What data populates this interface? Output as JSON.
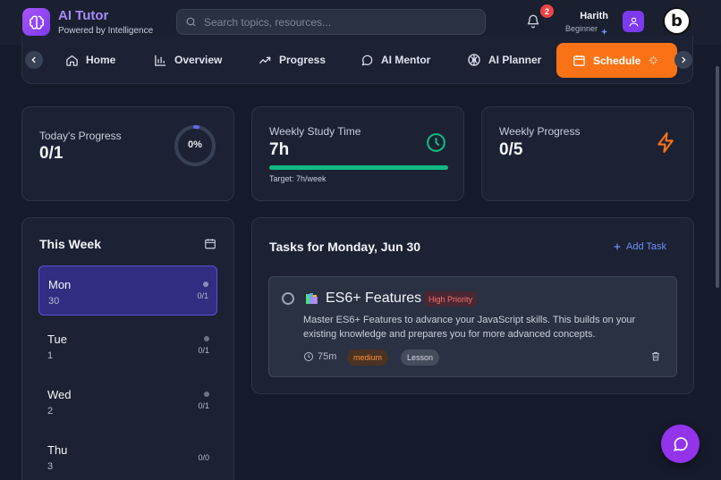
{
  "header": {
    "brand_title": "AI Tutor",
    "brand_subtitle": "Powered by Intelligence",
    "search_placeholder": "Search topics, resources...",
    "notification_count": "2",
    "user_name": "Harith",
    "user_level": "Beginner"
  },
  "nav": {
    "items": [
      {
        "label": "Home",
        "icon": "home-icon"
      },
      {
        "label": "Overview",
        "icon": "bar-chart-icon"
      },
      {
        "label": "Progress",
        "icon": "trending-up-icon"
      },
      {
        "label": "AI Mentor",
        "icon": "chat-icon"
      },
      {
        "label": "AI Planner",
        "icon": "brain-icon"
      },
      {
        "label": "Schedule",
        "icon": "calendar-icon",
        "active": true
      }
    ]
  },
  "stats": {
    "today": {
      "label": "Today's Progress",
      "value": "0/1",
      "percent_text": "0%",
      "percent": 0
    },
    "weekly_time": {
      "label": "Weekly Study Time",
      "value": "7h",
      "target": "Target: 7h/week",
      "fill_fraction": 1.0
    },
    "weekly_progress": {
      "label": "Weekly Progress",
      "value": "0/5"
    }
  },
  "week": {
    "title": "This Week",
    "days": [
      {
        "name": "Mon",
        "num": "30",
        "count": "0/1",
        "active": true
      },
      {
        "name": "Tue",
        "num": "1",
        "count": "0/1"
      },
      {
        "name": "Wed",
        "num": "2",
        "count": "0/1"
      },
      {
        "name": "Thu",
        "num": "3",
        "count": "0/0"
      }
    ]
  },
  "tasks": {
    "title": "Tasks for Monday, Jun 30",
    "add_label": "Add Task",
    "items": [
      {
        "title": "ES6+ Features",
        "priority": "High Priority",
        "description": "Master ES6+ Features to advance your JavaScript skills. This builds on your existing knowledge and prepares you for more advanced concepts.",
        "duration": "75m",
        "difficulty": "medium",
        "type": "Lesson"
      }
    ]
  },
  "colors": {
    "accent": "#f97316",
    "brand": "#a78bfa",
    "success": "#10b981",
    "danger": "#ef4444"
  }
}
